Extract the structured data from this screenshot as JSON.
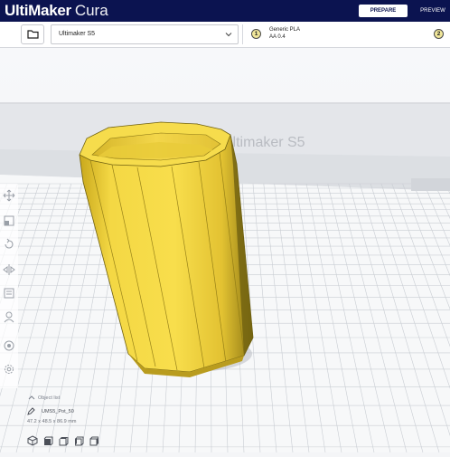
{
  "app": {
    "brand": "UltiMaker",
    "product": "Cura"
  },
  "stages": {
    "prepare": "PREPARE",
    "preview": "PREVIEW"
  },
  "printer": {
    "name": "Ultimaker S5"
  },
  "material": {
    "extruder1": "1",
    "extruder2": "2",
    "line1": "Generic PLA",
    "line2": "AA 0.4"
  },
  "scene": {
    "machine_branding": "Ultimaker S5"
  },
  "object": {
    "header": "Object list",
    "name": "UMS5_Pot_50",
    "dimensions": "47.2 x 48.5 x 86.9 mm"
  },
  "colors": {
    "header": "#0b1350",
    "model": "#f5d743",
    "model_shade": "#d8b623",
    "model_dark": "#9c8718",
    "grid": "#c9cdd3"
  }
}
